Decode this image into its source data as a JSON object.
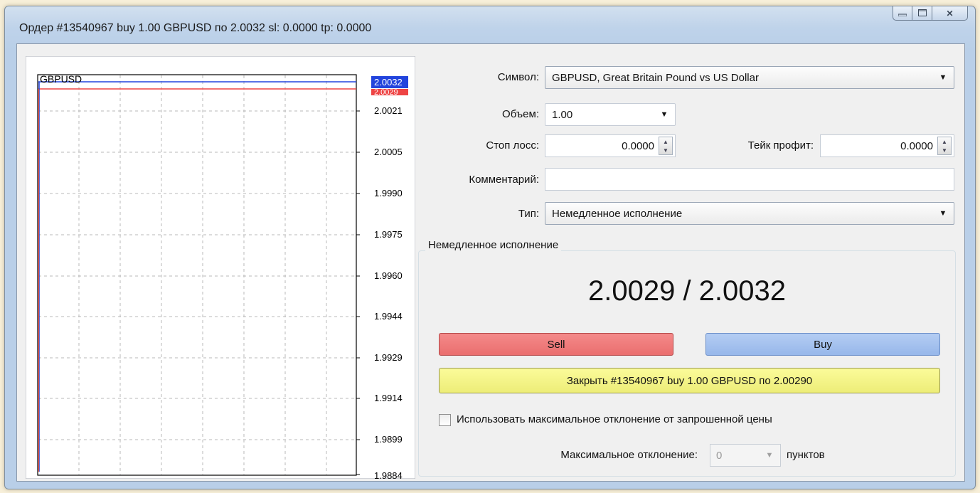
{
  "window": {
    "title": "Ордер #13540967 buy 1.00 GBPUSD по 2.0032 sl: 0.0000 tp: 0.0000",
    "minimize_icon": "minimize-icon",
    "maximize_icon": "maximize-icon",
    "close_icon": "close-icon"
  },
  "chart": {
    "symbol": "GBPUSD",
    "ask_badge": "2.0032",
    "bid_badge": "2.0029",
    "y_ticks": [
      "2.0021",
      "2.0005",
      "1.9990",
      "1.9975",
      "1.9960",
      "1.9944",
      "1.9929",
      "1.9914",
      "1.9899",
      "1.9884"
    ],
    "ask_color": "#2244dd",
    "bid_color": "#ee4444"
  },
  "form": {
    "symbol_label": "Символ:",
    "symbol_value": "GBPUSD, Great Britain Pound vs US Dollar",
    "volume_label": "Объем:",
    "volume_value": "1.00",
    "sl_label": "Стоп лосс:",
    "sl_value": "0.0000",
    "tp_label": "Тейк профит:",
    "tp_value": "0.0000",
    "comment_label": "Комментарий:",
    "comment_value": "",
    "type_label": "Тип:",
    "type_value": "Немедленное исполнение"
  },
  "execution": {
    "group_title": "Немедленное исполнение",
    "quote": "2.0029 / 2.0032",
    "sell_label": "Sell",
    "buy_label": "Buy",
    "close_label": "Закрыть #13540967 buy 1.00 GBPUSD по 2.00290",
    "deviation_checkbox_label": "Использовать максимальное отклонение от запрошенной цены",
    "deviation_checked": false,
    "max_deviation_label": "Максимальное отклонение:",
    "max_deviation_value": "0",
    "points_label": "пунктов"
  }
}
